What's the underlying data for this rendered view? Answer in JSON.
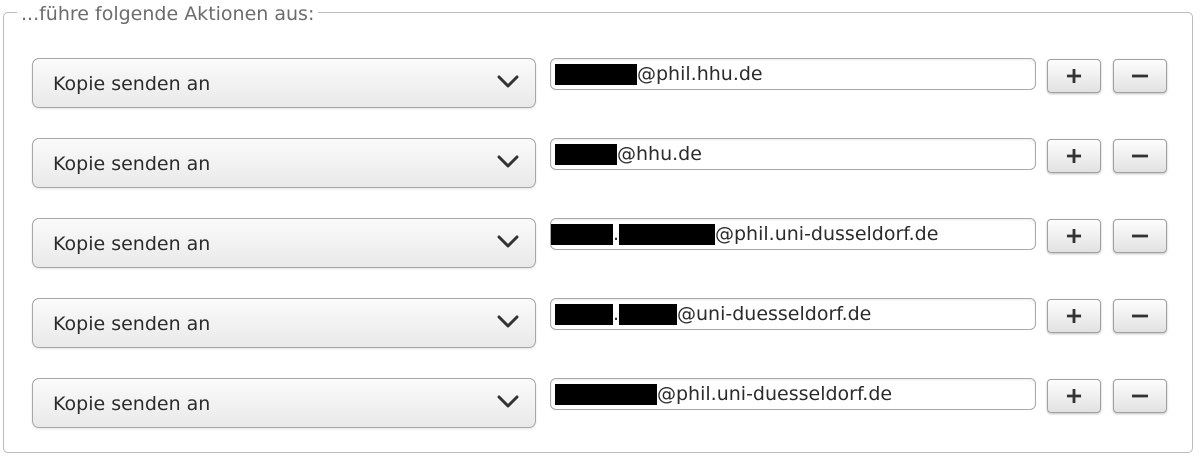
{
  "section": {
    "legend": "...führe folgende Aktionen aus:"
  },
  "actions": [
    {
      "action_label": "Kopie senden an",
      "email_suffix": "@phil.hhu.de"
    },
    {
      "action_label": "Kopie senden an",
      "email_suffix": "@hhu.de"
    },
    {
      "action_label": "Kopie senden an",
      "email_separator": ".",
      "email_suffix": "@phil.uni-dusseldorf.de"
    },
    {
      "action_label": "Kopie senden an",
      "email_separator": ".",
      "email_suffix": "@uni-duesseldorf.de"
    },
    {
      "action_label": "Kopie senden an",
      "email_suffix": "@phil.uni-duesseldorf.de"
    }
  ],
  "icons": {
    "select_arrow": "chevron-down-icon",
    "add": "plus-icon",
    "remove": "minus-icon"
  },
  "colors": {
    "border": "#bcbcbc",
    "legend_text": "#6c6c6c",
    "redaction": "#000000"
  }
}
